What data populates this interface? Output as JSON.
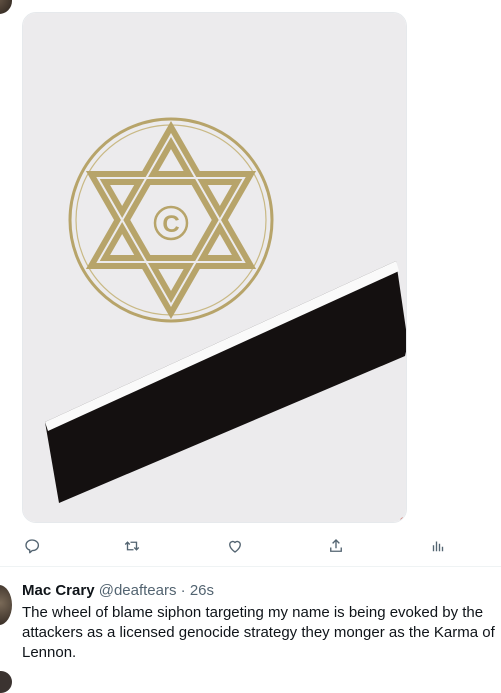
{
  "tweet1": {
    "media": {
      "logo_letter": "C"
    },
    "actions": [
      {
        "name": "reply-icon"
      },
      {
        "name": "retweet-icon"
      },
      {
        "name": "like-icon"
      },
      {
        "name": "share-icon"
      },
      {
        "name": "analytics-icon"
      }
    ]
  },
  "tweet2": {
    "name": "Mac Crary",
    "handle": "@deaftears",
    "separator": "·",
    "time": "26s",
    "text": "The wheel of blame siphon targeting my name is being evoked by the attackers as a licensed genocide strategy they monger as the Karma of Lennon."
  },
  "colors": {
    "card_bg": "#ecebed",
    "gold": "#b7a46a",
    "band_black": "#141010",
    "icon_gray": "#536471",
    "text": "#0f1419",
    "muted": "#536471"
  }
}
